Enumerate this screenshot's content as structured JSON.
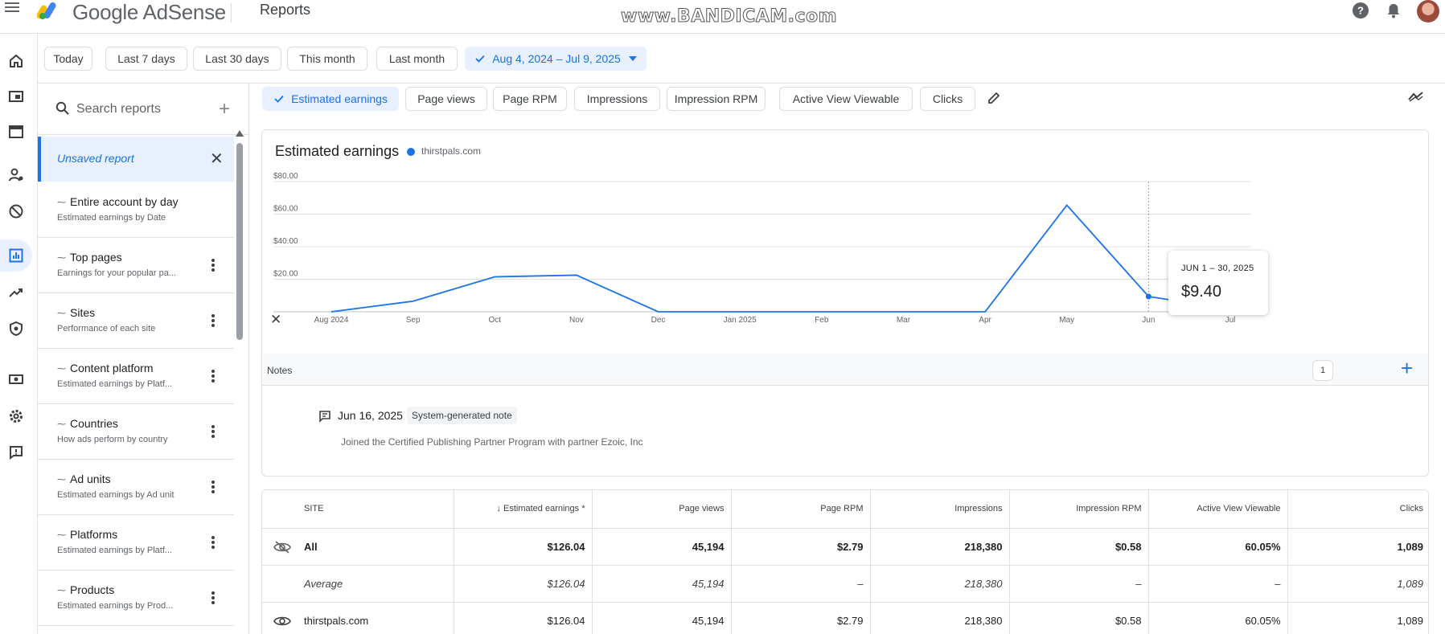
{
  "app": {
    "brand": "Google AdSense",
    "page_title": "Reports",
    "watermark": "www.BANDICAM.com"
  },
  "date_ranges": {
    "items": [
      "Today",
      "Last 7 days",
      "Last 30 days",
      "This month",
      "Last month"
    ],
    "selected": "Aug 4, 2024 – Jul 9, 2025"
  },
  "sidebar": {
    "search_placeholder": "Search reports",
    "unsaved": "Unsaved report",
    "reports": [
      {
        "title": "Entire account by day",
        "subtitle": "Estimated earnings by Date"
      },
      {
        "title": "Top pages",
        "subtitle": "Earnings for your popular pa..."
      },
      {
        "title": "Sites",
        "subtitle": "Performance of each site"
      },
      {
        "title": "Content platform",
        "subtitle": "Estimated earnings by Platf..."
      },
      {
        "title": "Countries",
        "subtitle": "How ads perform by country"
      },
      {
        "title": "Ad units",
        "subtitle": "Estimated earnings by Ad unit"
      },
      {
        "title": "Platforms",
        "subtitle": "Estimated earnings by Platf..."
      },
      {
        "title": "Products",
        "subtitle": "Estimated earnings by Prod..."
      }
    ]
  },
  "metrics": {
    "items": [
      "Estimated earnings",
      "Page views",
      "Page RPM",
      "Impressions",
      "Impression RPM",
      "Active View Viewable",
      "Clicks"
    ],
    "selected_index": 0
  },
  "chart": {
    "title": "Estimated earnings",
    "legend": "thirstpals.com",
    "tooltip_range": "JUN 1 – 30, 2025",
    "tooltip_value": "$9.40"
  },
  "chart_data": {
    "type": "line",
    "x": [
      "Aug 2024",
      "Sep",
      "Oct",
      "Nov",
      "Dec",
      "Jan 2025",
      "Feb",
      "Mar",
      "Apr",
      "May",
      "Jun",
      "Jul"
    ],
    "series": [
      {
        "name": "thirstpals.com",
        "values": [
          0,
          6.5,
          21.5,
          22.5,
          0,
          0,
          0,
          0,
          0,
          65.5,
          9.4,
          1.5
        ]
      }
    ],
    "yticks": [
      "$20.00",
      "$40.00",
      "$60.00",
      "$80.00"
    ],
    "ylim": [
      0,
      80
    ],
    "grid": true,
    "legend_position": "top-left",
    "line_color": "#1a73e8"
  },
  "notes": {
    "label": "Notes",
    "count": "1",
    "date": "Jun 16, 2025",
    "badge": "System-generated note",
    "text": "Joined the Certified Publishing Partner Program with partner Ezoic, Inc"
  },
  "table": {
    "headers": [
      "SITE",
      "↓ Estimated earnings *",
      "Page views",
      "Page RPM",
      "Impressions",
      "Impression RPM",
      "Active View Viewable",
      "Clicks"
    ],
    "rows": [
      {
        "site": "All",
        "earnings": "$126.04",
        "page_views": "45,194",
        "page_rpm": "$2.79",
        "impressions": "218,380",
        "impression_rpm": "$0.58",
        "viewable": "60.05%",
        "clicks": "1,089"
      },
      {
        "site": "Average",
        "earnings": "$126.04",
        "page_views": "45,194",
        "page_rpm": "–",
        "impressions": "218,380",
        "impression_rpm": "–",
        "viewable": "–",
        "clicks": "1,089"
      },
      {
        "site": "thirstpals.com",
        "earnings": "$126.04",
        "page_views": "45,194",
        "page_rpm": "$2.79",
        "impressions": "218,380",
        "impression_rpm": "$0.58",
        "viewable": "60.05%",
        "clicks": "1,089"
      }
    ]
  },
  "colors": {
    "accent": "#1a73e8",
    "selected_bg": "#e8f0fe"
  }
}
